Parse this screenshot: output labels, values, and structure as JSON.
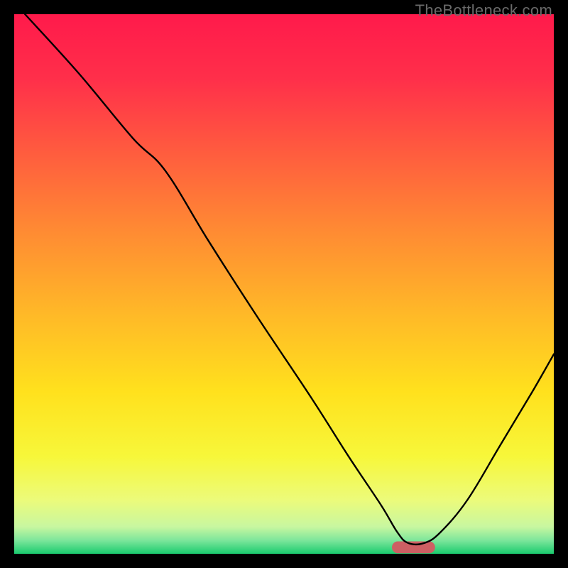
{
  "watermark": "TheBottleneck.com",
  "chart_data": {
    "type": "line",
    "title": "",
    "xlabel": "",
    "ylabel": "",
    "xlim": [
      0,
      100
    ],
    "ylim": [
      0,
      100
    ],
    "grid": false,
    "legend": false,
    "background_gradient": {
      "stops": [
        {
          "offset": 0.0,
          "color": "#ff1a4b"
        },
        {
          "offset": 0.12,
          "color": "#ff2f4a"
        },
        {
          "offset": 0.25,
          "color": "#ff5a3f"
        },
        {
          "offset": 0.4,
          "color": "#ff8a33"
        },
        {
          "offset": 0.55,
          "color": "#ffb728"
        },
        {
          "offset": 0.7,
          "color": "#ffe11d"
        },
        {
          "offset": 0.82,
          "color": "#f7f73a"
        },
        {
          "offset": 0.9,
          "color": "#ecfb7a"
        },
        {
          "offset": 0.95,
          "color": "#c8f7a0"
        },
        {
          "offset": 0.975,
          "color": "#7de69b"
        },
        {
          "offset": 1.0,
          "color": "#1acb6e"
        }
      ]
    },
    "series": [
      {
        "name": "bottleneck-curve",
        "color": "#000000",
        "stroke_width": 2.4,
        "x": [
          2,
          12,
          22,
          28,
          36,
          45,
          55,
          62,
          68,
          71,
          73,
          76,
          79,
          84,
          90,
          96,
          100
        ],
        "y": [
          100,
          89,
          77,
          71,
          58,
          44,
          29,
          18,
          9,
          4,
          2,
          2,
          4,
          10,
          20,
          30,
          37
        ]
      }
    ],
    "marker": {
      "name": "optimal-range",
      "shape": "rounded-bar",
      "color": "#cd5f63",
      "x_start": 70,
      "x_end": 78,
      "y": 1.2,
      "height": 2.2
    }
  }
}
